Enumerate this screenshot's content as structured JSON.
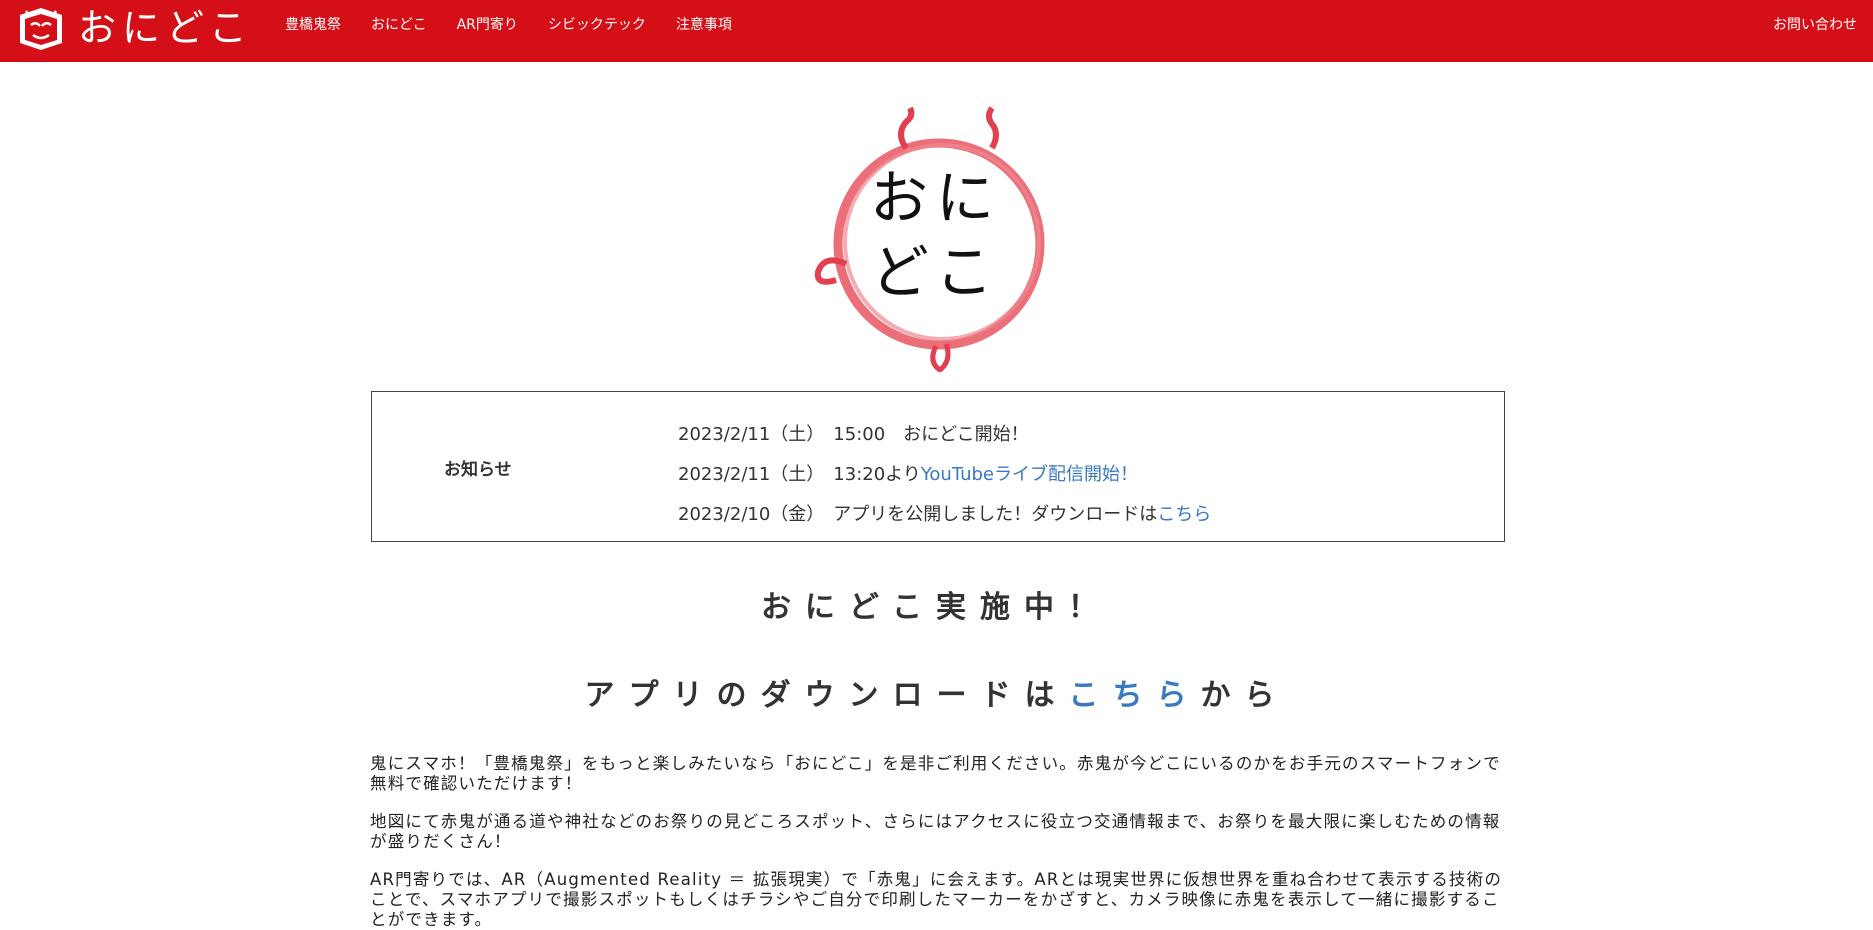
{
  "header": {
    "brand": "おにどこ",
    "nav": [
      "豊橋鬼祭",
      "おにどこ",
      "AR門寄り",
      "シビックテック",
      "注意事項"
    ],
    "contact": "お問い合わせ",
    "bg_color": "#d50f18"
  },
  "hero": {
    "logo_line1": "おに",
    "logo_line2": "どこ"
  },
  "news": {
    "title": "お知らせ",
    "items": [
      {
        "text": "2023/2/11（土）　15:00　おにどこ開始！",
        "link": ""
      },
      {
        "text": "2023/2/11（土）　13:20より",
        "link": "YouTubeライブ配信開始！"
      },
      {
        "text": "2023/2/10（金）　アプリを公開しました！ダウンロードは",
        "link": "こちら"
      }
    ]
  },
  "headline1": "おにどこ実施中！",
  "headline2": {
    "before": "アプリのダウンロードは",
    "link": "こちら",
    "after": "から"
  },
  "paragraphs": [
    "鬼にスマホ！「豊橋鬼祭」をもっと楽しみたいなら「おにどこ」を是非ご利用ください。赤鬼が今どこにいるのかをお手元のスマートフォンで無料で確認いただけます！",
    "地図にて赤鬼が通る道や神社などのお祭りの見どころスポット、さらにはアクセスに役立つ交通情報まで、お祭りを最大限に楽しむための情報が盛りだくさん！",
    "AR門寄りでは、AR（Augmented Reality ＝ 拡張現実）で「赤鬼」に会えます。ARとは現実世界に仮想世界を重ね合わせて表示する技術のことで、スマホアプリで撮影スポットもしくはチラシやご自分で印刷したマーカーをかざすと、カメラ映像に赤鬼を表示して一緒に撮影することができます。"
  ],
  "colors": {
    "accent_red": "#d50f18",
    "link_blue": "#3a78c0"
  }
}
